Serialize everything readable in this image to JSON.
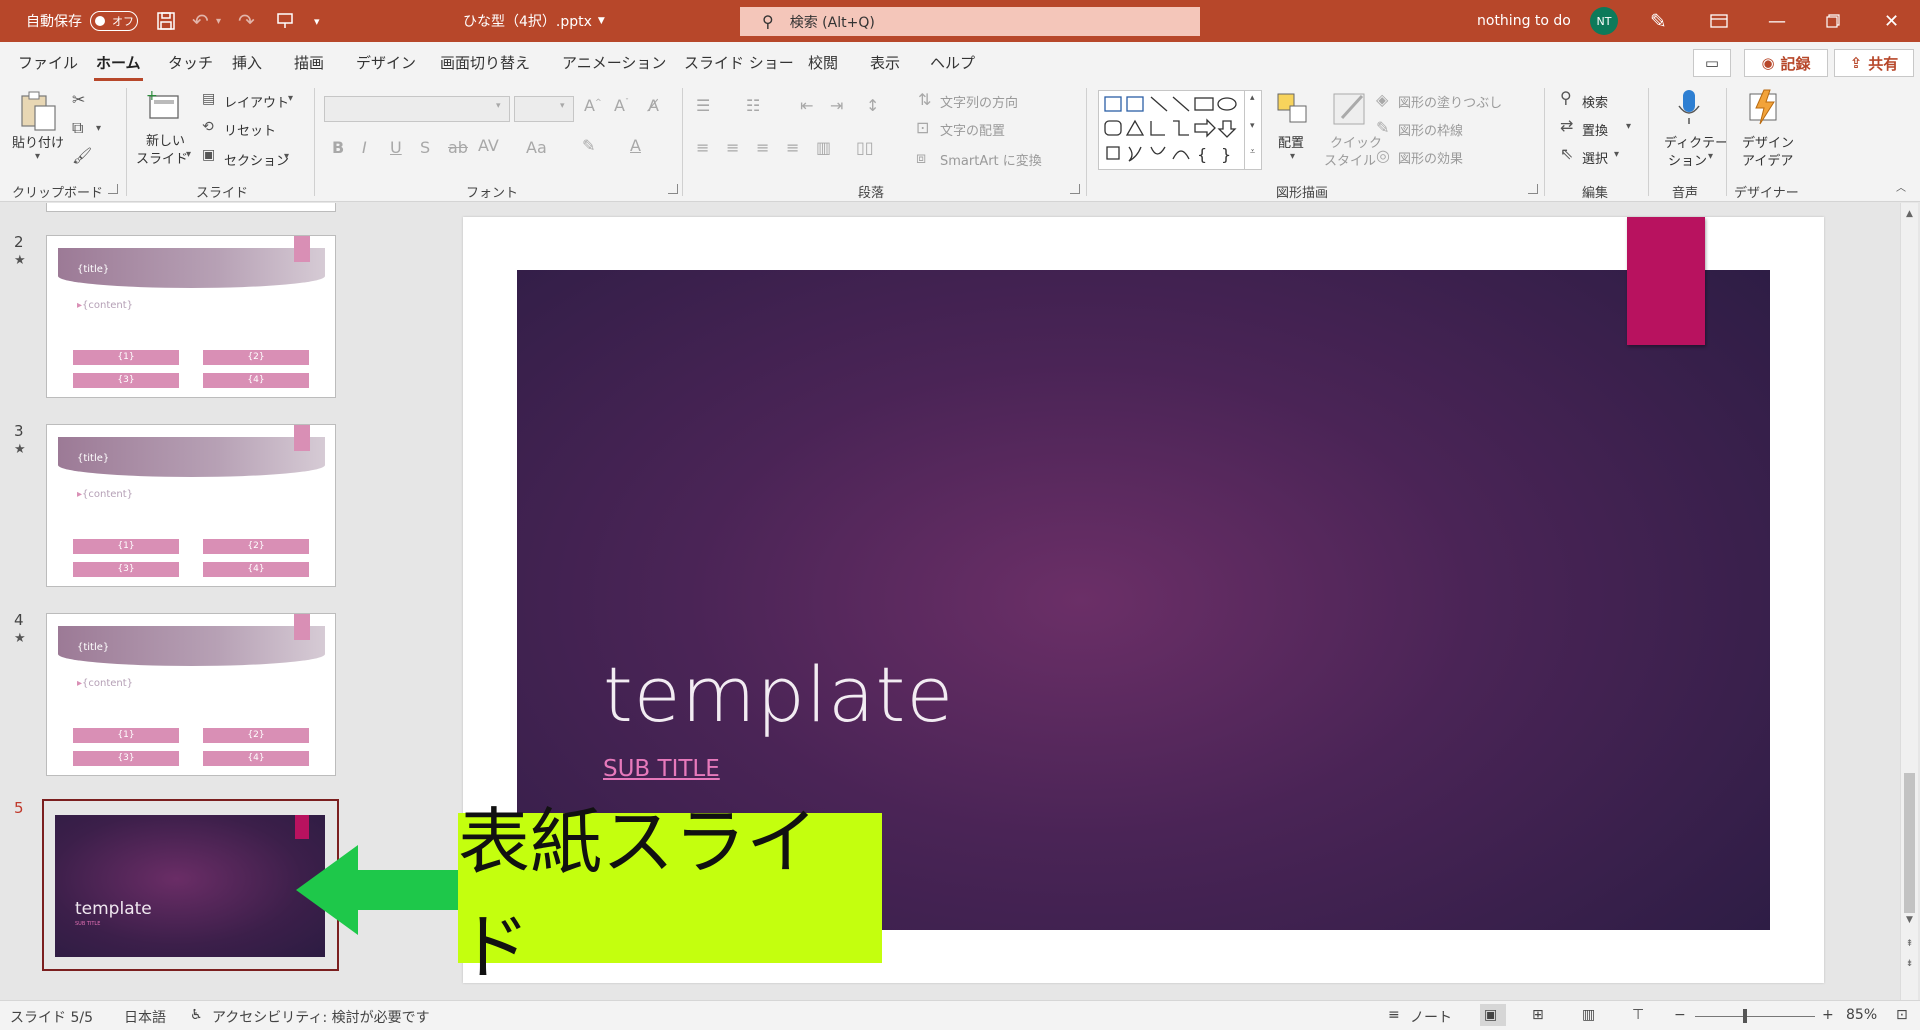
{
  "titlebar": {
    "autosave_label": "自動保存",
    "autosave_state": "オフ",
    "filename": "ひな型（4択）.pptx",
    "search_placeholder": "検索 (Alt+Q)",
    "user_status": "nothing to do",
    "user_initials": "NT",
    "bg_color": "#b7472a"
  },
  "tabs": [
    "ファイル",
    "ホーム",
    "タッチ",
    "挿入",
    "描画",
    "デザイン",
    "画面切り替え",
    "アニメーション",
    "スライド ショー",
    "校閲",
    "表示",
    "ヘルプ"
  ],
  "active_tab": "ホーム",
  "top_buttons": {
    "record": "記録",
    "share": "共有"
  },
  "ribbon": {
    "clipboard": {
      "paste": "貼り付け",
      "group": "クリップボード"
    },
    "slides": {
      "new_slide_1": "新しい",
      "new_slide_2": "スライド",
      "layout": "レイアウト",
      "reset": "リセット",
      "section": "セクション",
      "group": "スライド"
    },
    "font": {
      "group": "フォント"
    },
    "paragraph": {
      "text_direction": "文字列の方向",
      "align_text": "文字の配置",
      "smartart": "SmartArt に変換",
      "group": "段落"
    },
    "drawing": {
      "arrange": "配置",
      "quick_styles_1": "クイック",
      "quick_styles_2": "スタイル",
      "fill": "図形の塗りつぶし",
      "outline": "図形の枠線",
      "effects": "図形の効果",
      "group": "図形描画"
    },
    "editing": {
      "find": "検索",
      "replace": "置換",
      "select": "選択",
      "group": "編集"
    },
    "voice": {
      "dictate_1": "ディクテー",
      "dictate_2": "ション",
      "group": "音声"
    },
    "designer": {
      "ideas_1": "デザイン",
      "ideas_2": "アイデア",
      "group": "デザイナー"
    }
  },
  "thumbnails": [
    {
      "number": "2",
      "title": "{title}",
      "content": "{content}",
      "boxes": [
        "{1}",
        "{2}",
        "{3}",
        "{4}"
      ]
    },
    {
      "number": "3",
      "title": "{title}",
      "content": "{content}",
      "boxes": [
        "{1}",
        "{2}",
        "{3}",
        "{4}"
      ]
    },
    {
      "number": "4",
      "title": "{title}",
      "content": "{content}",
      "boxes": [
        "{1}",
        "{2}",
        "{3}",
        "{4}"
      ]
    }
  ],
  "selected_thumb": {
    "number": "5",
    "title": "template",
    "subtitle": "SUB TITLE"
  },
  "slide": {
    "title": "template",
    "subtitle": "SUB TITLE"
  },
  "annotation": {
    "label": "表紙スライド",
    "callout_color": "#c4ff0e",
    "arrow_color": "#1ec84a"
  },
  "statusbar": {
    "slide_counter": "スライド 5/5",
    "language": "日本語",
    "accessibility": "アクセシビリティ: 検討が必要です",
    "notes": "ノート",
    "zoom": "85%"
  }
}
